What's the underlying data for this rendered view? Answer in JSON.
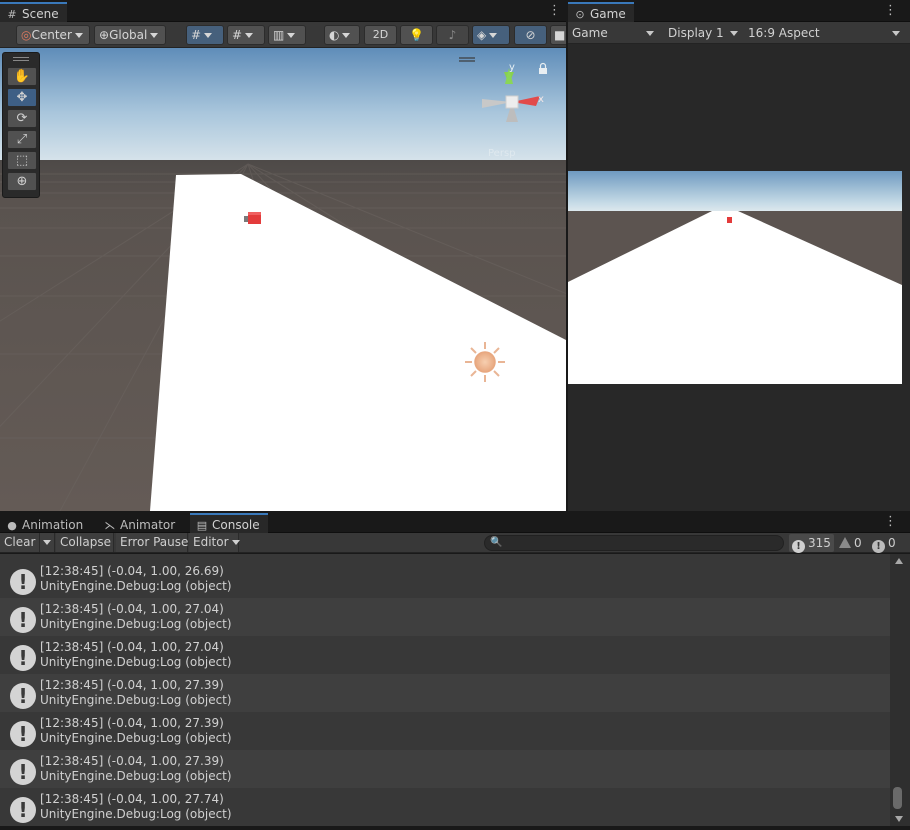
{
  "scene_tab": {
    "icon": "grid-icon",
    "label": "Scene"
  },
  "game_tab": {
    "icon": "gamepad-icon",
    "label": "Game"
  },
  "scene_toolbar": {
    "pivot_label": "Center",
    "space_label": "Global",
    "mode_2d_label": "2D"
  },
  "scene_view": {
    "gizmo_axes": {
      "y": "y",
      "x": "x"
    },
    "gizmo_projection": "Persp",
    "colors": {
      "sky_top": "#5f8db9",
      "horizon": "#c9dbe8",
      "ground": "#5e5651",
      "plane": "#ffffff",
      "cube": "#e33b3b"
    }
  },
  "game_toolbar": {
    "display_mode": "Game",
    "display": "Display 1",
    "aspect": "16:9 Aspect"
  },
  "bottom_tabs": [
    {
      "icon": "animation-icon",
      "label": "Animation"
    },
    {
      "icon": "animator-icon",
      "label": "Animator"
    },
    {
      "icon": "console-icon",
      "label": "Console"
    }
  ],
  "console_toolbar": {
    "clear_label": "Clear",
    "collapse_label": "Collapse",
    "error_pause_label": "Error Pause",
    "editor_label": "Editor",
    "search_placeholder": "",
    "log_count": "315",
    "warning_count": "0",
    "error_count": "0"
  },
  "console_rows": [
    {
      "line1": "[12:38:45] (-0.04, 1.00, 26.69)",
      "line2": "UnityEngine.Debug:Log (object)"
    },
    {
      "line1": "[12:38:45] (-0.04, 1.00, 27.04)",
      "line2": "UnityEngine.Debug:Log (object)"
    },
    {
      "line1": "[12:38:45] (-0.04, 1.00, 27.04)",
      "line2": "UnityEngine.Debug:Log (object)"
    },
    {
      "line1": "[12:38:45] (-0.04, 1.00, 27.39)",
      "line2": "UnityEngine.Debug:Log (object)"
    },
    {
      "line1": "[12:38:45] (-0.04, 1.00, 27.39)",
      "line2": "UnityEngine.Debug:Log (object)"
    },
    {
      "line1": "[12:38:45] (-0.04, 1.00, 27.39)",
      "line2": "UnityEngine.Debug:Log (object)"
    },
    {
      "line1": "[12:38:45] (-0.04, 1.00, 27.74)",
      "line2": "UnityEngine.Debug:Log (object)"
    }
  ]
}
